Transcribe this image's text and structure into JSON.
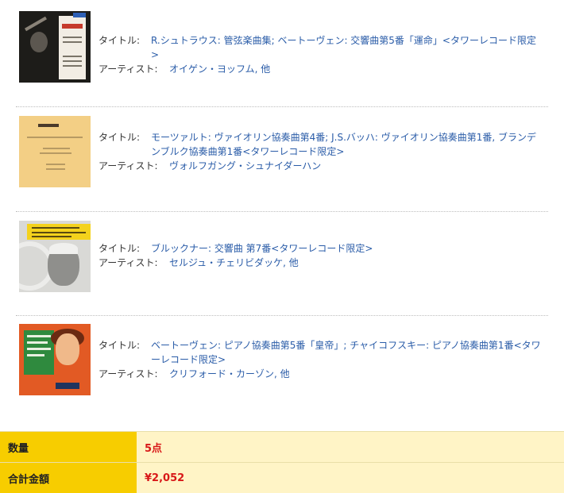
{
  "items": [
    {
      "title_label": "タイトル:",
      "title": "R.シュトラウス: 管弦楽曲集; ベートーヴェン: 交響曲第5番「運命」<タワーレコード限定>",
      "artist_label": "アーティスト:",
      "artist": "オイゲン・ヨッフム, 他",
      "thumb_icon": "album-cover"
    },
    {
      "title_label": "タイトル:",
      "title": "モーツァルト: ヴァイオリン協奏曲第4番; J.S.バッハ: ヴァイオリン協奏曲第1番, ブランデンブルク協奏曲第1番<タワーレコード限定>",
      "artist_label": "アーティスト:",
      "artist": "ヴォルフガング・シュナイダーハン",
      "thumb_icon": "album-cover"
    },
    {
      "title_label": "タイトル:",
      "title": "ブルックナー: 交響曲 第7番<タワーレコード限定>",
      "artist_label": "アーティスト:",
      "artist": "セルジュ・チェリビダッケ, 他",
      "thumb_icon": "album-cover"
    },
    {
      "title_label": "タイトル:",
      "title": "ベートーヴェン: ピアノ協奏曲第5番「皇帝」; チャイコフスキー: ピアノ協奏曲第1番<タワーレコード限定>",
      "artist_label": "アーティスト:",
      "artist": "クリフォード・カーゾン, 他",
      "thumb_icon": "album-cover"
    }
  ],
  "summary": {
    "quantity_label": "数量",
    "quantity_value": "5点",
    "total_label": "合計金額",
    "total_value": "¥2,052"
  },
  "colors": {
    "link": "#2a5ca8",
    "summary_header_bg": "#f7cd00",
    "summary_value_bg": "#fff4c6",
    "price_red": "#d81818"
  }
}
